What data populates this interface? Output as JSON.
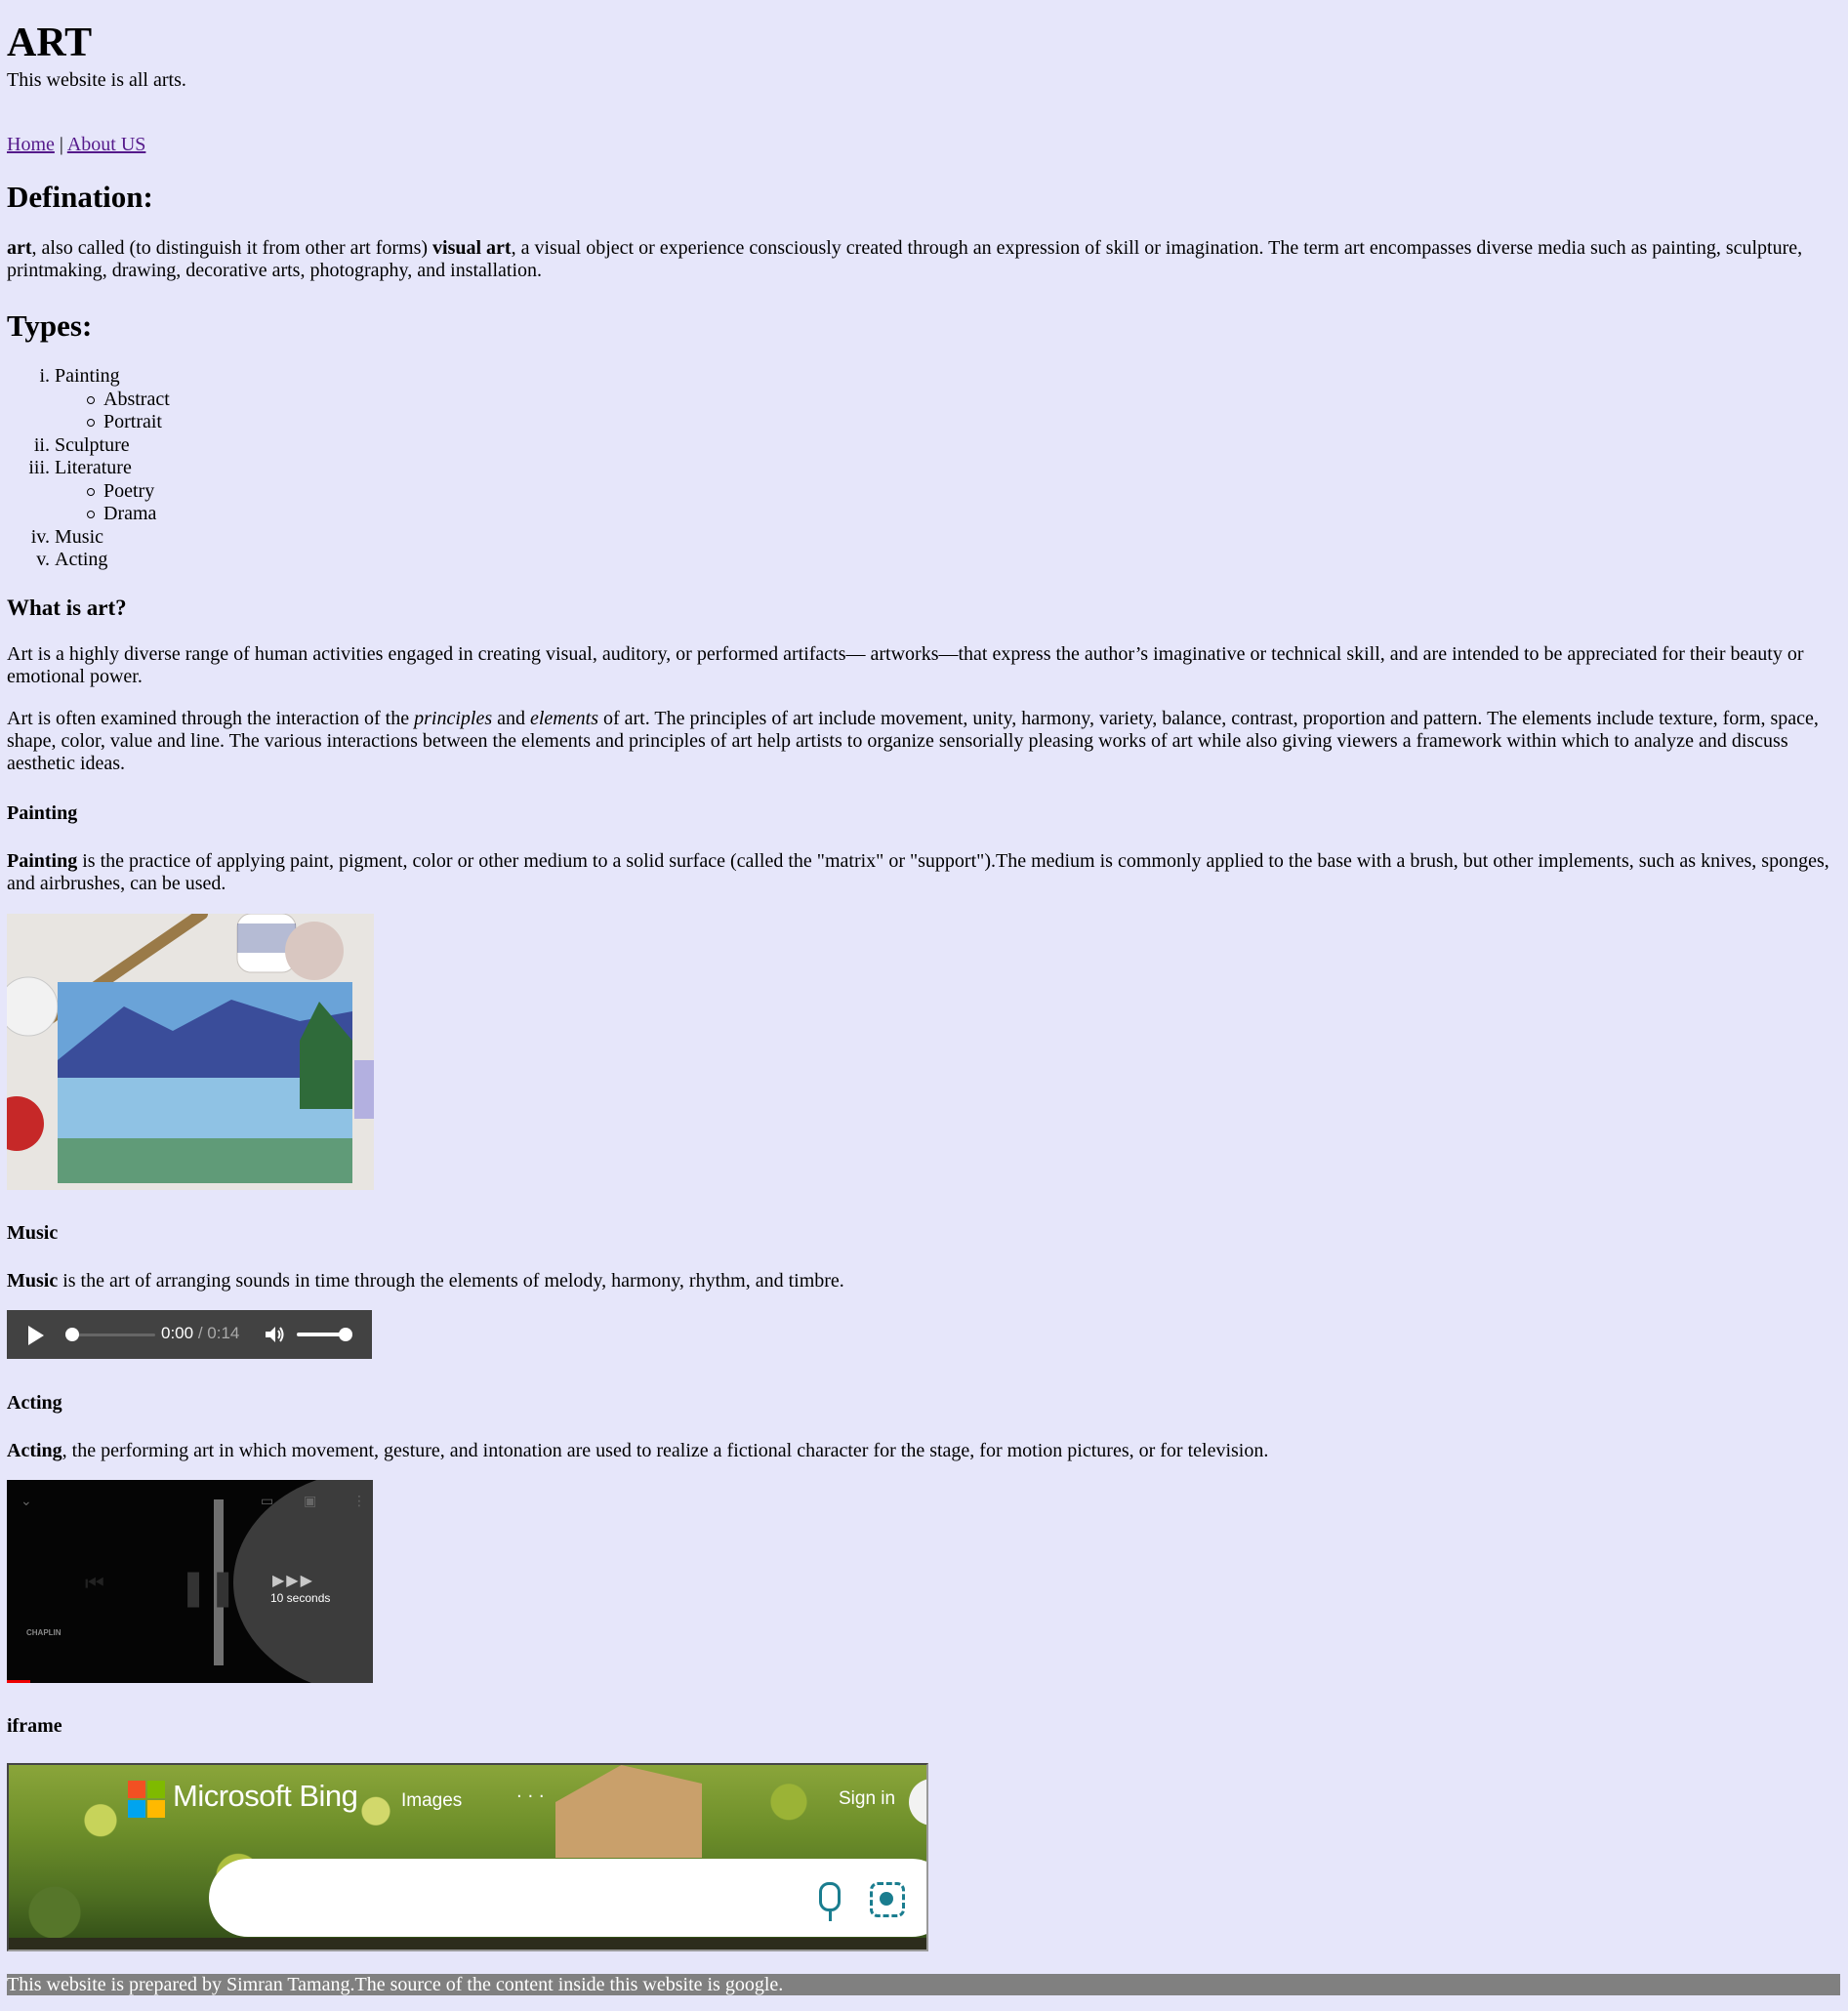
{
  "header": {
    "title": "ART",
    "tagline": "This website is all arts.",
    "nav": {
      "home": "Home",
      "separator": "|",
      "about": "About US"
    }
  },
  "definition": {
    "heading": "Defination:",
    "term1": "art",
    "text1": ", also called (to distinguish it from other art forms) ",
    "term2": "visual art",
    "text2": ", a visual object or experience consciously created through an expression of skill or imagination. The term art encompasses diverse media such as painting, sculpture, printmaking, drawing, decorative arts, photography, and installation."
  },
  "types": {
    "heading": "Types:",
    "items": [
      {
        "num": "i.",
        "label": "Painting",
        "sub": [
          "Abstract",
          "Portrait"
        ]
      },
      {
        "num": "ii.",
        "label": "Sculpture",
        "sub": []
      },
      {
        "num": "iii.",
        "label": "Literature",
        "sub": [
          "Poetry",
          "Drama"
        ]
      },
      {
        "num": "iv.",
        "label": "Music",
        "sub": []
      },
      {
        "num": "v.",
        "label": "Acting",
        "sub": []
      }
    ]
  },
  "what_is_art": {
    "heading": "What is art?",
    "para1": "Art is a highly diverse range of human activities engaged in creating visual, auditory, or performed artifacts— artworks—that express the author’s imaginative or technical skill, and are intended to be appreciated for their beauty or emotional power.",
    "para2_a": "Art is often examined through the interaction of the ",
    "para2_em1": "principles",
    "para2_b": " and ",
    "para2_em2": "elements",
    "para2_c": " of art. The principles of art include movement, unity, harmony, variety, balance, contrast, proportion and pattern. The elements include texture, form, space, shape, color, value and line. The various interactions between the elements and principles of art help artists to organize sensorially pleasing works of art while also giving viewers a framework within which to analyze and discuss aesthetic ideas."
  },
  "painting": {
    "heading": "Painting",
    "term": "Painting",
    "text": " is the practice of applying paint, pigment, color or other medium to a solid surface (called the \"matrix\" or \"support\").The medium is commonly applied to the base with a brush, but other implements, such as knives, sponges, and airbrushes, can be used."
  },
  "music": {
    "heading": "Music",
    "term": "Music",
    "text": " is the art of arranging sounds in time through the elements of melody, harmony, rhythm, and timbre.",
    "player": {
      "current": "0:00",
      "separator": " / ",
      "duration": "0:14",
      "progress": 0.0,
      "volume": 1.0
    }
  },
  "acting": {
    "heading": "Acting",
    "term": "Acting",
    "text": ", the performing art in which movement, gesture, and intonation are used to realize a fictional character for the stage, for motion pictures, or for television.",
    "video": {
      "skip_label": "10 seconds",
      "caption": "CHAPLIN"
    }
  },
  "iframe": {
    "heading": "iframe",
    "brand": "Microsoft Bing",
    "images_label": "Images",
    "more_label": "· · ·",
    "signin_label": "Sign in",
    "colors": {
      "ms_red": "#f25022",
      "ms_green": "#7fba00",
      "ms_blue": "#00a4ef",
      "ms_yellow": "#ffb900",
      "accent": "#1a7d8f"
    }
  },
  "footer": {
    "text": "This website is prepared by Simran Tamang.The source of the content inside this website is google."
  },
  "colors": {
    "background": "#e6e6fa",
    "footer_bg": "#808080",
    "link": "#551a8b"
  }
}
